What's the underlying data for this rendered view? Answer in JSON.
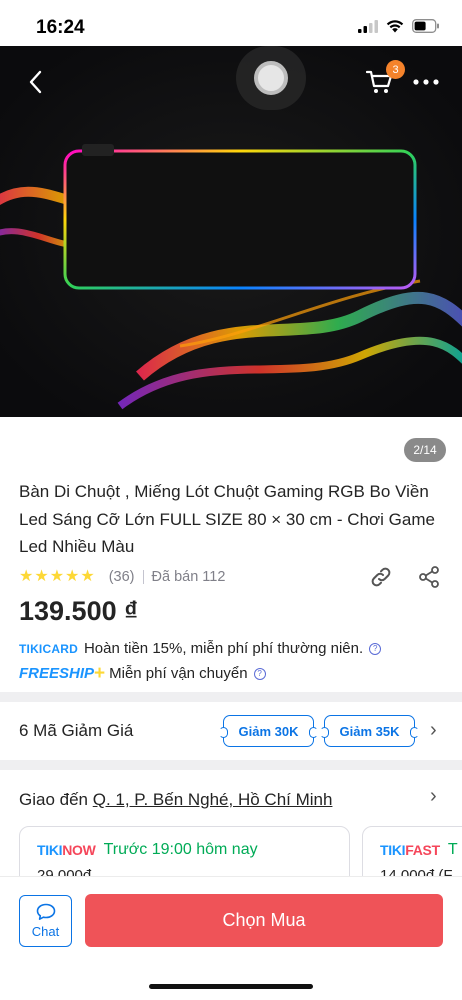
{
  "status_bar": {
    "time": "16:24"
  },
  "header": {
    "cart_count": "3"
  },
  "gallery": {
    "counter": "2/14"
  },
  "product": {
    "title": "Bàn Di Chuột , Miếng Lót Chuột Gaming RGB Bo Viền Led Sáng Cỡ Lớn  FULL SIZE 80 × 30 cm - Chơi Game Led Nhiều Màu",
    "rating_stars": 5,
    "review_count": "(36)",
    "sold": "Đã bán 112",
    "price": "139.500 ₫"
  },
  "promos": {
    "tikicard_logo_main": "TIKI",
    "tikicard_logo_sub": "CARD",
    "tikicard_text": "Hoàn tiền 15%, miễn phí phí thường niên.",
    "freeship_logo": "FREESHIP",
    "freeship_text": "Miễn phí vận chuyển"
  },
  "coupons": {
    "title": "6 Mã Giảm Giá",
    "chips": [
      "Giảm 30K",
      "Giảm 35K"
    ]
  },
  "delivery": {
    "prefix": "Giao đến",
    "address": "Q. 1, P. Bến Nghé, Hồ Chí Minh",
    "cards": [
      {
        "logo_a": "TIKI",
        "logo_b": "NOW",
        "time": "Trước 19:00 hôm nay",
        "fee": "29.000đ"
      },
      {
        "logo_a": "TIKI",
        "logo_b": "FAST",
        "time": "T",
        "fee": "14.000đ (F"
      }
    ]
  },
  "bottom": {
    "chat_label": "Chat",
    "buy_label": "Chọn Mua"
  },
  "colors": {
    "accent_blue": "#0b74e5",
    "buy_red": "#ef5358",
    "star_yellow": "#fdd836",
    "badge_orange": "#f5832b",
    "green": "#00ab56"
  }
}
